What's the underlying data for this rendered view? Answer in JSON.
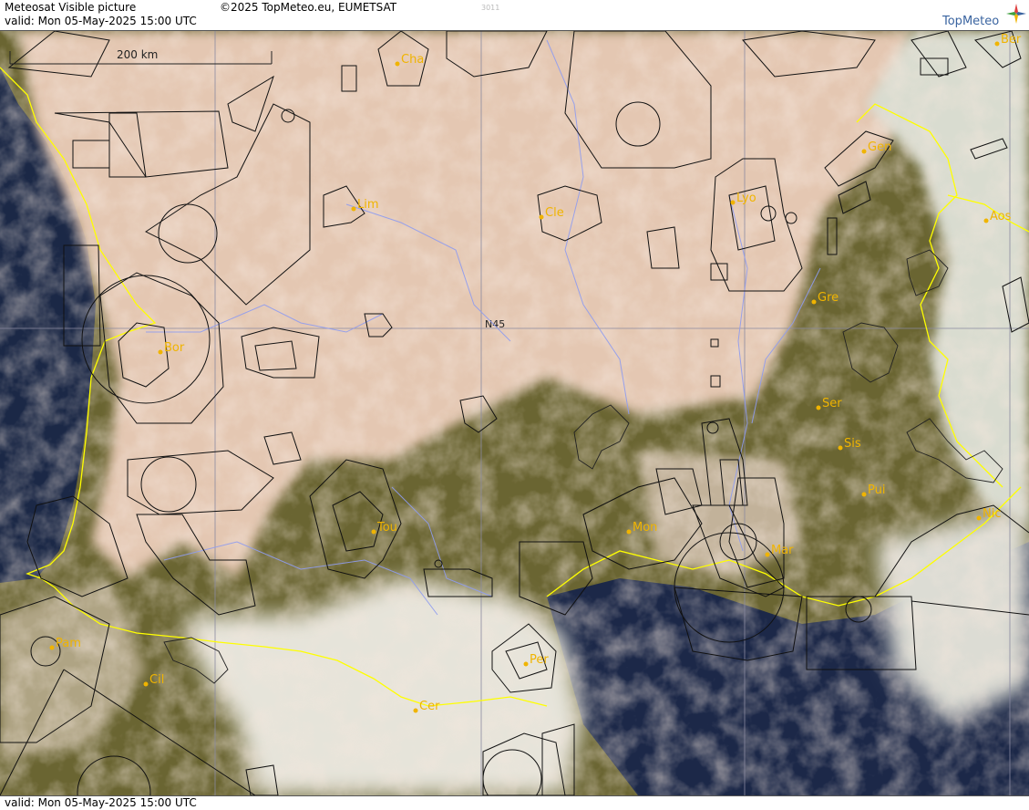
{
  "header": {
    "title": "Meteosat Visible picture",
    "valid": "valid:  Mon  05-May-2025  15:00 UTC",
    "copyright": "©2025 TopMeteo.eu, EUMETSAT",
    "image_id": "3011",
    "logo_text": "TopMeteo"
  },
  "footer": {
    "valid": "valid:  Mon  05-May-2025  15:00 UTC"
  },
  "map": {
    "scale_label": "200 km",
    "latitude_label": "N45",
    "cities": [
      {
        "name": "Cha"
      },
      {
        "name": "Ber"
      },
      {
        "name": "Gen"
      },
      {
        "name": "Lim"
      },
      {
        "name": "Cle"
      },
      {
        "name": "Lyo"
      },
      {
        "name": "Aos"
      },
      {
        "name": "Gre"
      },
      {
        "name": "Bor"
      },
      {
        "name": "Ser"
      },
      {
        "name": "Sis"
      },
      {
        "name": "Pui"
      },
      {
        "name": "Tou"
      },
      {
        "name": "Mon"
      },
      {
        "name": "Nic"
      },
      {
        "name": "Mar"
      },
      {
        "name": "Pam"
      },
      {
        "name": "Per"
      },
      {
        "name": "Cil"
      },
      {
        "name": "Cer"
      }
    ]
  },
  "colors": {
    "city_label": "#f0b400",
    "border_line": "#ffff00",
    "river_line": "#8f9cf0",
    "airspace_line": "#111111",
    "sea": "#1e2a4a",
    "cloud": "#e8cdb9",
    "land": "#5e5a2c"
  }
}
